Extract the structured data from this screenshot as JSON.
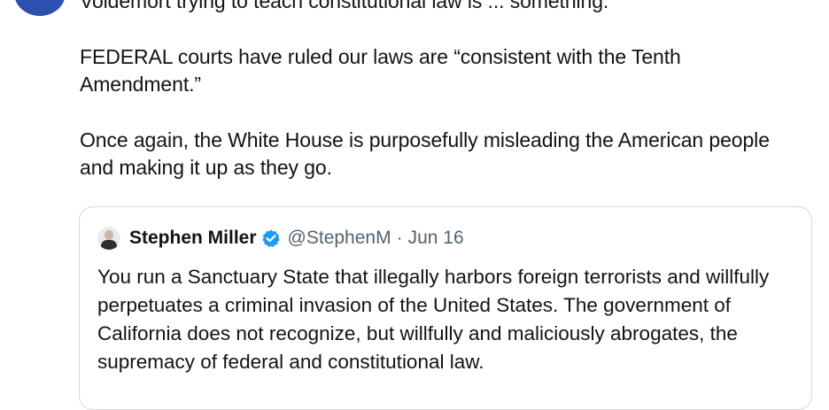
{
  "tweet": {
    "paragraphs": [
      "Voldemort trying to teach constitutional law is ... something.",
      "FEDERAL courts have ruled our laws are “consistent with the Tenth Amendment.”",
      "Once again, the White House is purposefully misleading the American people and making it up as they go."
    ]
  },
  "quote": {
    "name": "Stephen Miller",
    "handle": "@StephenM",
    "separator": "·",
    "date": "Jun 16",
    "text": "You run a Sanctuary State that illegally harbors foreign terrorists and willfully perpetuates a criminal invasion of the United States. The government of California does not recognize, but willfully and maliciously abrogates, the supremacy of federal and constitutional law.",
    "verified_icon": "verified-badge-icon"
  },
  "colors": {
    "text_primary": "#0f1419",
    "text_secondary": "#536471",
    "border": "#cfd9de",
    "verified_blue": "#1d9bf0",
    "avatar_blue": "#2d4fb0"
  }
}
